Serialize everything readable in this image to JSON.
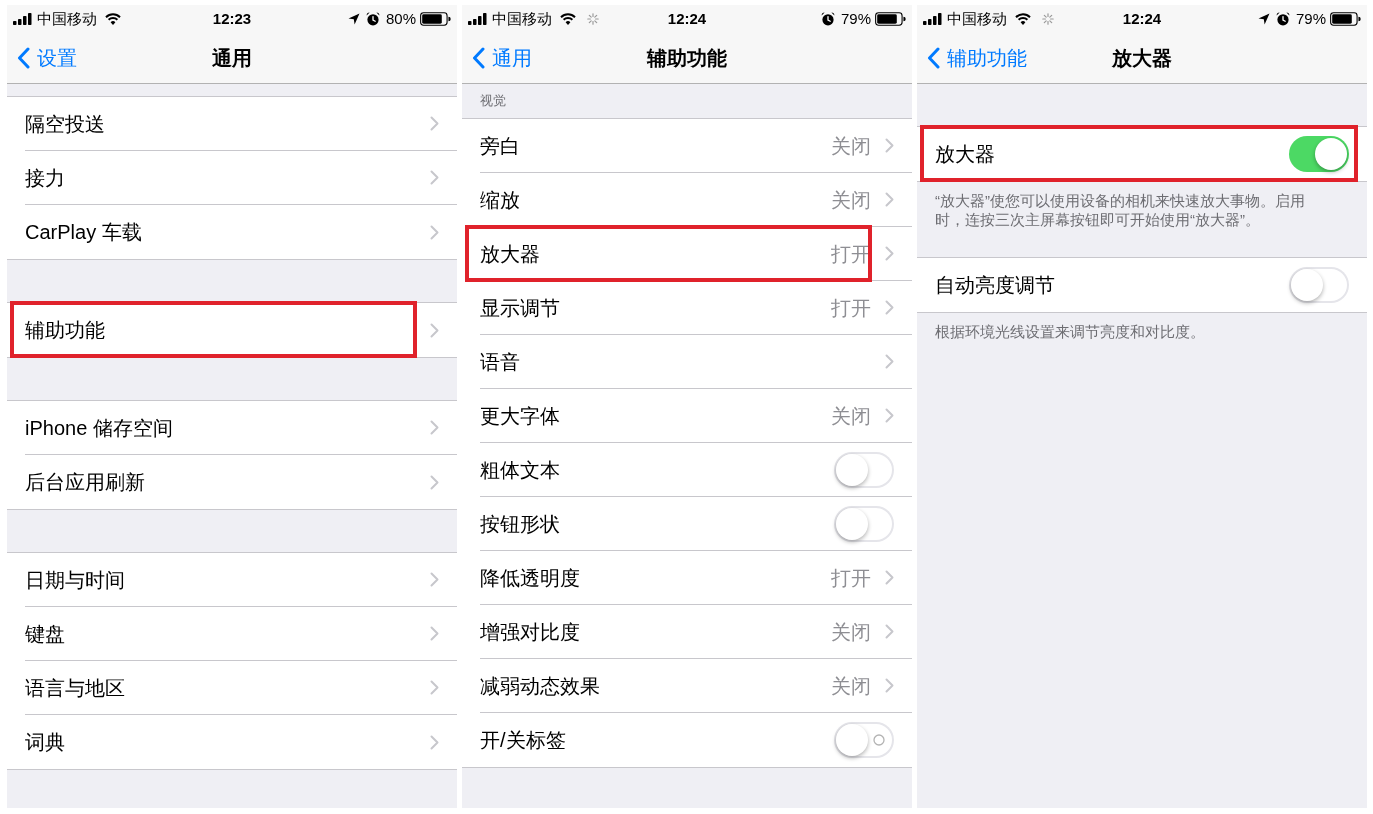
{
  "screens": [
    {
      "status_bar": {
        "carrier": "中国移动",
        "activity": false,
        "time": "12:23",
        "location": true,
        "alarm": true,
        "battery": "80%"
      },
      "nav": {
        "back": "设置",
        "title": "通用"
      },
      "groups": [
        {
          "rows": [
            {
              "kind": "disclosure",
              "label": "隔空投送",
              "highlighted": false
            },
            {
              "kind": "disclosure",
              "label": "接力",
              "highlighted": false
            },
            {
              "kind": "disclosure",
              "label": "CarPlay 车载",
              "highlighted": false
            }
          ]
        },
        {
          "rows": [
            {
              "kind": "disclosure",
              "label": "辅助功能",
              "highlighted": true
            }
          ]
        },
        {
          "rows": [
            {
              "kind": "disclosure",
              "label": "iPhone 储存空间",
              "highlighted": false
            },
            {
              "kind": "disclosure",
              "label": "后台应用刷新",
              "highlighted": false
            }
          ]
        },
        {
          "rows": [
            {
              "kind": "disclosure",
              "label": "日期与时间",
              "highlighted": false
            },
            {
              "kind": "disclosure",
              "label": "键盘",
              "highlighted": false
            },
            {
              "kind": "disclosure",
              "label": "语言与地区",
              "highlighted": false
            },
            {
              "kind": "disclosure",
              "label": "词典",
              "highlighted": false
            }
          ]
        }
      ]
    },
    {
      "status_bar": {
        "carrier": "中国移动",
        "activity": true,
        "time": "12:24",
        "location": false,
        "alarm": true,
        "battery": "79%"
      },
      "nav": {
        "back": "通用",
        "title": "辅助功能"
      },
      "groups": [
        {
          "header": "视觉",
          "rows": [
            {
              "kind": "disclosure",
              "label": "旁白",
              "value": "关闭",
              "highlighted": false
            },
            {
              "kind": "disclosure",
              "label": "缩放",
              "value": "关闭",
              "highlighted": false
            },
            {
              "kind": "disclosure",
              "label": "放大器",
              "value": "打开",
              "highlighted": true
            },
            {
              "kind": "disclosure",
              "label": "显示调节",
              "value": "打开",
              "highlighted": false
            },
            {
              "kind": "disclosure",
              "label": "语音",
              "highlighted": false
            },
            {
              "kind": "disclosure",
              "label": "更大字体",
              "value": "关闭",
              "highlighted": false
            },
            {
              "kind": "toggle",
              "label": "粗体文本",
              "on": false,
              "on_off_labels": false,
              "highlighted": false
            },
            {
              "kind": "toggle",
              "label": "按钮形状",
              "on": false,
              "on_off_labels": false,
              "highlighted": false
            },
            {
              "kind": "disclosure",
              "label": "降低透明度",
              "value": "打开",
              "highlighted": false
            },
            {
              "kind": "disclosure",
              "label": "增强对比度",
              "value": "关闭",
              "highlighted": false
            },
            {
              "kind": "disclosure",
              "label": "减弱动态效果",
              "value": "关闭",
              "highlighted": false
            },
            {
              "kind": "toggle",
              "label": "开/关标签",
              "on": false,
              "on_off_labels": true,
              "highlighted": false
            }
          ]
        }
      ]
    },
    {
      "status_bar": {
        "carrier": "中国移动",
        "activity": true,
        "time": "12:24",
        "location": true,
        "alarm": true,
        "battery": "79%"
      },
      "nav": {
        "back": "辅助功能",
        "title": "放大器"
      },
      "groups": [
        {
          "rows": [
            {
              "kind": "toggle",
              "label": "放大器",
              "on": true,
              "on_off_labels": false,
              "highlighted": true
            }
          ],
          "footer": "“放大器”使您可以使用设备的相机来快速放大事物。启用时，连按三次主屏幕按钮即可开始使用“放大器”。"
        },
        {
          "rows": [
            {
              "kind": "toggle",
              "label": "自动亮度调节",
              "on": false,
              "on_off_labels": false,
              "highlighted": false
            }
          ],
          "footer": "根据环境光线设置来调节亮度和对比度。"
        }
      ]
    }
  ]
}
